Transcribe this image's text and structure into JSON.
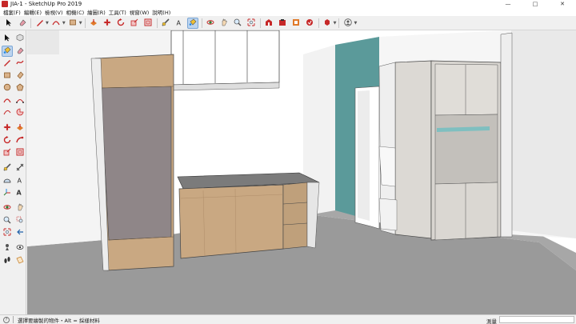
{
  "window": {
    "title": "JIA-1 - SketchUp Pro 2019",
    "minimize_glyph": "—",
    "maximize_glyph": "□",
    "close_glyph": "✕"
  },
  "menu": [
    {
      "label": "檔案(F)"
    },
    {
      "label": "編輯(E)"
    },
    {
      "label": "檢視(V)"
    },
    {
      "label": "相機(C)"
    },
    {
      "label": "繪圖(R)"
    },
    {
      "label": "工具(T)"
    },
    {
      "label": "視窗(W)"
    },
    {
      "label": "說明(H)"
    }
  ],
  "toolbar": [
    {
      "icon": "select-arrow-icon"
    },
    {
      "icon": "eraser-icon"
    },
    {
      "sep": true
    },
    {
      "icon": "line-pencil-icon",
      "dropdown": true
    },
    {
      "icon": "arc-icon",
      "dropdown": true
    },
    {
      "icon": "shape-rectangle-icon",
      "dropdown": true
    },
    {
      "sep": true
    },
    {
      "icon": "push-pull-icon"
    },
    {
      "icon": "move-icon"
    },
    {
      "icon": "rotate-icon"
    },
    {
      "icon": "scale-icon"
    },
    {
      "icon": "offset-icon"
    },
    {
      "sep": true
    },
    {
      "icon": "tape-measure-icon"
    },
    {
      "icon": "text-icon"
    },
    {
      "icon": "paint-bucket-icon",
      "active": true
    },
    {
      "sep": true
    },
    {
      "icon": "orbit-icon"
    },
    {
      "icon": "pan-icon"
    },
    {
      "icon": "zoom-icon"
    },
    {
      "icon": "zoom-extents-icon"
    },
    {
      "sep": true
    },
    {
      "icon": "3d-warehouse-icon"
    },
    {
      "icon": "extension-warehouse-icon"
    },
    {
      "icon": "layout-icon"
    },
    {
      "icon": "extension-manager-icon"
    },
    {
      "sep": true
    },
    {
      "icon": "ruby-icon",
      "dropdown": true
    },
    {
      "sep": true
    },
    {
      "icon": "account-icon",
      "dropdown": true
    }
  ],
  "palette": [
    "select-arrow-icon",
    "component-icon",
    "paint-bucket-icon",
    "eraser-icon",
    "pencil-icon",
    "freehand-icon",
    "rectangle-icon",
    "rotated-rectangle-icon",
    "circle-icon",
    "polygon-icon",
    "arc-icon",
    "two-point-arc-icon",
    "three-point-arc-icon",
    "pie-icon",
    "gap",
    "move-icon",
    "push-pull-icon",
    "rotate-icon",
    "follow-me-icon",
    "scale-icon",
    "offset-icon",
    "gap",
    "tape-measure-icon",
    "dimension-icon",
    "protractor-icon",
    "text-icon",
    "axes-icon",
    "3d-text-icon",
    "gap",
    "orbit-icon",
    "pan-icon",
    "zoom-icon",
    "zoom-window-icon",
    "zoom-extents-icon",
    "previous-view-icon",
    "gap",
    "position-camera-icon",
    "look-around-icon",
    "walk-icon",
    "section-plane-icon"
  ],
  "palette_active": "paint-bucket-icon",
  "status": {
    "info_glyph": "?",
    "hint": "選擇要繪製的物件・Alt = 採樣材料",
    "measure_label": "測量"
  },
  "colors": {
    "wood": "#c9a882",
    "teal_wall": "#5b9a9a",
    "panel_mauve": "#8f8688",
    "ground": "#9a9a9a",
    "cabinet_light": "#d8d5d0",
    "active_tool": "#bcd4ef"
  }
}
